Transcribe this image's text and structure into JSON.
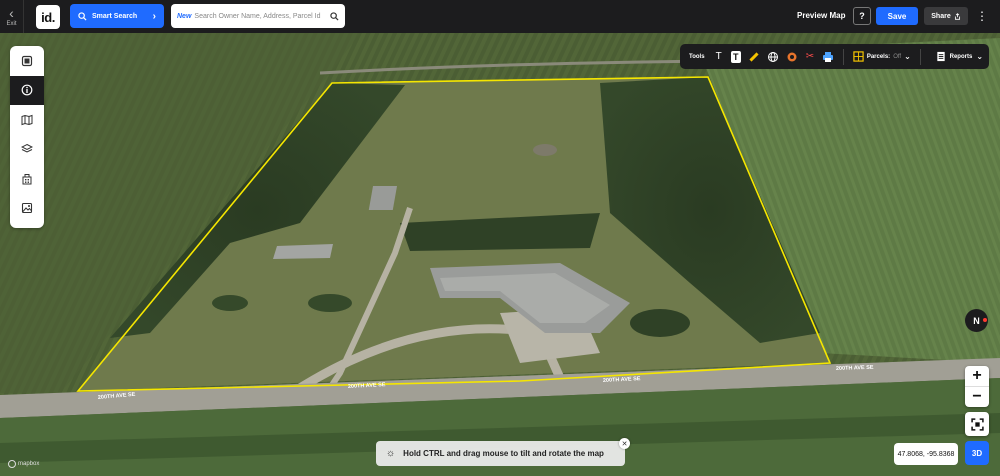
{
  "topbar": {
    "exit_label": "Exit",
    "logo_text": "id.",
    "smart_search_label": "Smart Search",
    "search_new_badge": "New",
    "search_placeholder": "Search Owner Name, Address, Parcel Id",
    "preview_map_label": "Preview Map",
    "help_label": "?",
    "save_label": "Save",
    "share_label": "Share"
  },
  "sidebar": {
    "items": [
      {
        "icon": "layers-panel-icon",
        "active": true
      },
      {
        "icon": "info-icon",
        "active": false
      },
      {
        "icon": "map-book-icon",
        "active": false
      },
      {
        "icon": "layers-icon",
        "active": false
      },
      {
        "icon": "buildings-icon",
        "active": false
      },
      {
        "icon": "image-icon",
        "active": false
      }
    ]
  },
  "toolbar": {
    "tools_label": "Tools",
    "parcels_label": "Parcels:",
    "parcels_state": "Off",
    "reports_label": "Reports"
  },
  "map": {
    "road_labels": [
      "200TH AVE SE",
      "200TH AVE SE",
      "200TH AVE SE",
      "200TH AVE SE"
    ],
    "boundary_color": "#f5e600"
  },
  "compass": {
    "label": "N"
  },
  "coords": "47.8068, -95.8368",
  "view_mode": "3D",
  "hint": {
    "text": "Hold CTRL and drag mouse to tilt and rotate the map"
  },
  "attribution": "mapbox",
  "colors": {
    "accent": "#1f6bff",
    "dark": "#1c1c1e"
  }
}
